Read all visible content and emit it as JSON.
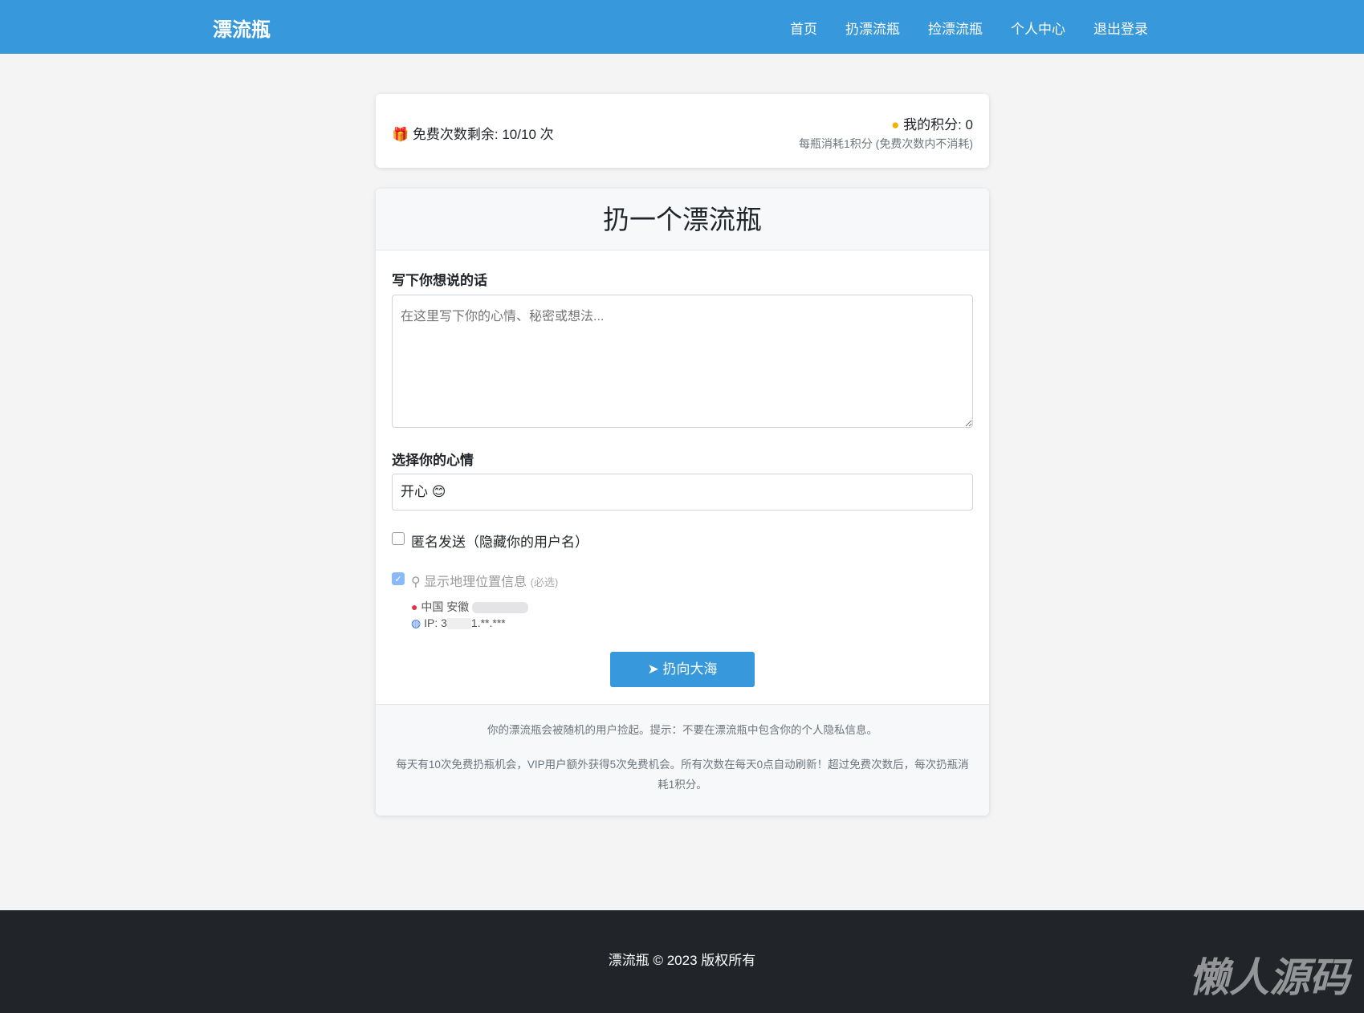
{
  "nav": {
    "brand": "漂流瓶",
    "links": [
      "首页",
      "扔漂流瓶",
      "捡漂流瓶",
      "个人中心",
      "退出登录"
    ]
  },
  "status": {
    "free": "免费次数剩余: 10/10 次",
    "points": "我的积分: 0",
    "note": "每瓶消耗1积分 (免费次数内不消耗)"
  },
  "form": {
    "title": "扔一个漂流瓶",
    "message_label": "写下你想说的话",
    "message_placeholder": "在这里写下你的心情、秘密或想法...",
    "mood_label": "选择你的心情",
    "mood_value": "开心 😊",
    "anonymous_label": "匿名发送（隐藏你的用户名）",
    "location_label": "显示地理位置信息",
    "location_required": "(必选)",
    "location": "中国 安徽",
    "ip": "IP: 3",
    "ip_tail": "1.**.***",
    "submit": "扔向大海"
  },
  "tips": {
    "line1": "你的漂流瓶会被随机的用户捡起。提示：不要在漂流瓶中包含你的个人隐私信息。",
    "line2": "每天有10次免费扔瓶机会，VIP用户额外获得5次免费机会。所有次数在每天0点自动刷新！超过免费次数后，每次扔瓶消耗1积分。"
  },
  "footer": {
    "text": "漂流瓶 © 2023 版权所有",
    "watermark": "懒人源码"
  }
}
